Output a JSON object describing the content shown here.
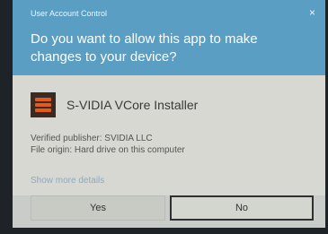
{
  "dialog": {
    "window_title": "User Account Control",
    "close_glyph": "×",
    "question": "Do you want to allow this app to make changes to your device?",
    "app_icon": "app-logo-icon",
    "app_name": "S-VIDIA VCore Installer",
    "publisher_line": "Verified publisher: SVIDIA LLC",
    "origin_line": "File origin: Hard drive on this computer",
    "more_details_link": "Show more details",
    "yes_label": "Yes",
    "no_label": "No"
  },
  "colors": {
    "header_bg": "#5a9ec3",
    "body_bg": "#d8d8d2",
    "link": "#8aa8c8",
    "logo_accent": "#e35a1c"
  }
}
